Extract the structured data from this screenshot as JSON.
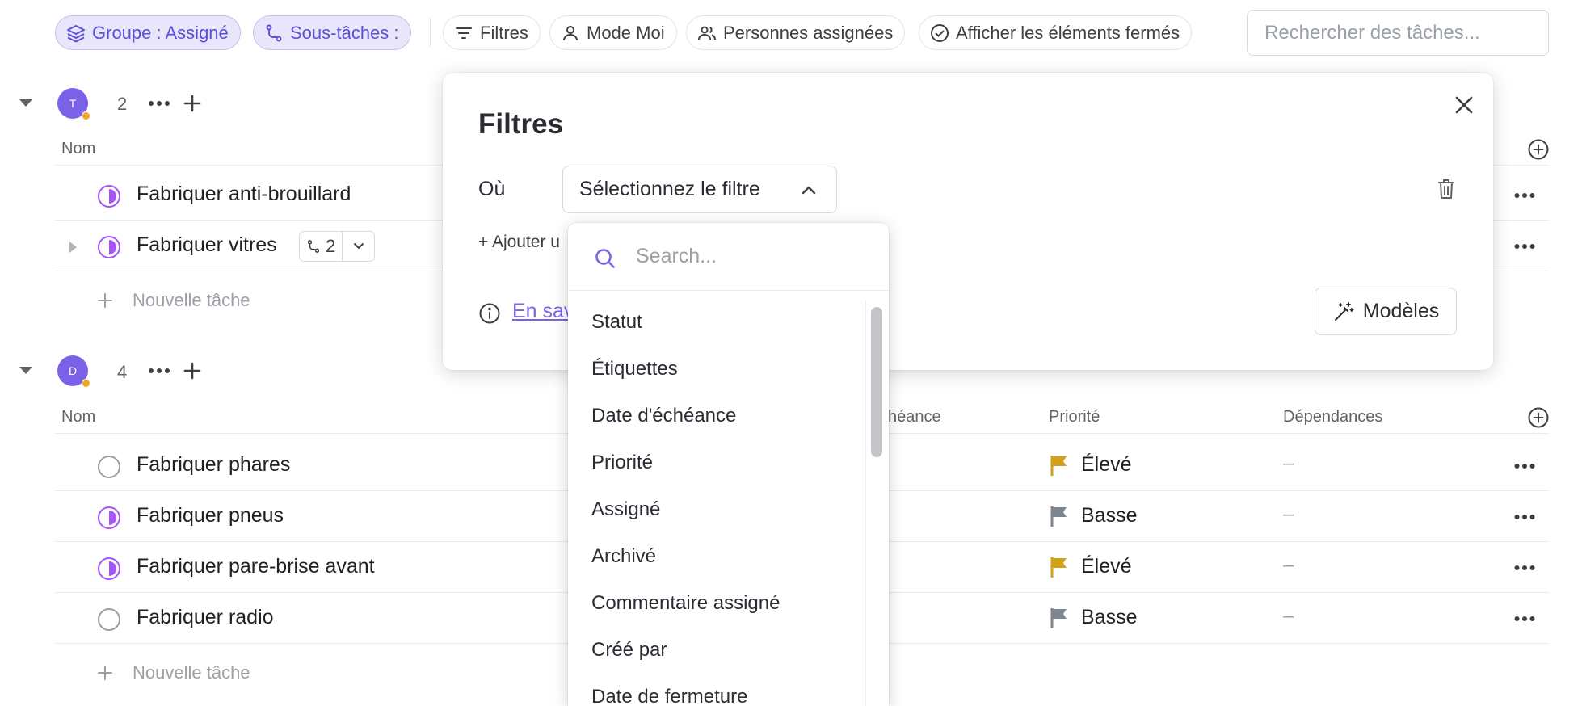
{
  "toolbar": {
    "group_chip": "Groupe : Assigné",
    "subtasks_chip": "Sous-tâches :",
    "filters": "Filtres",
    "mode_me": "Mode Moi",
    "assignees": "Personnes assignées",
    "show_closed": "Afficher les éléments fermés",
    "search_placeholder": "Rechercher des tâches..."
  },
  "groups": [
    {
      "avatar": "T",
      "count": "2",
      "columns": {
        "name": "Nom"
      },
      "tasks": [
        {
          "name": "Fabriquer anti-brouillard",
          "status": "in-progress"
        },
        {
          "name": "Fabriquer vitres",
          "status": "in-progress",
          "subtasks": "2"
        }
      ],
      "new_task": "Nouvelle tâche"
    },
    {
      "avatar": "D",
      "count": "4",
      "columns": {
        "name": "Nom",
        "due_partial": "chéance",
        "priority": "Priorité",
        "dependencies": "Dépendances"
      },
      "tasks": [
        {
          "name": "Fabriquer phares",
          "status": "todo",
          "priority": "Élevé",
          "priority_color": "#d4a017",
          "dependencies": "–"
        },
        {
          "name": "Fabriquer pneus",
          "status": "in-progress",
          "priority": "Basse",
          "priority_color": "#7d8590",
          "dependencies": "–"
        },
        {
          "name": "Fabriquer pare-brise avant",
          "status": "in-progress",
          "priority": "Élevé",
          "priority_color": "#d4a017",
          "dependencies": "–"
        },
        {
          "name": "Fabriquer radio",
          "status": "todo",
          "priority": "Basse",
          "priority_color": "#7d8590",
          "dependencies": "–"
        }
      ],
      "new_task": "Nouvelle tâche"
    }
  ],
  "filter_modal": {
    "title": "Filtres",
    "where_label": "Où",
    "select_placeholder": "Sélectionnez le filtre",
    "add_filter_partial": "+ Ajouter u",
    "learn_more_partial": "En sav",
    "templates_button": "Modèles"
  },
  "filter_dropdown": {
    "search_placeholder": "Search...",
    "options": [
      "Statut",
      "Étiquettes",
      "Date d'échéance",
      "Priorité",
      "Assigné",
      "Archivé",
      "Commentaire assigné",
      "Créé par",
      "Date de fermeture"
    ]
  },
  "colors": {
    "accent": "#7b61e8",
    "chip_active_bg": "#e9e6fb",
    "status_in_progress": "#a855f7",
    "avatar_status": "#f5a623"
  }
}
